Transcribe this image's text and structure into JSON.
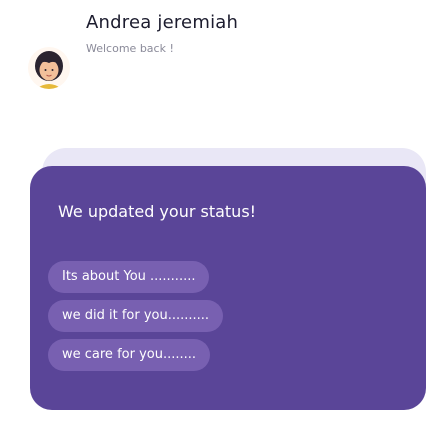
{
  "header": {
    "name": "Andrea jeremiah",
    "subtitle": "Welcome back !"
  },
  "card": {
    "title": "We updated your  status!",
    "messages": [
      "Its about You ...........",
      "we did it for you..........",
      "we care for you........"
    ]
  },
  "colors": {
    "card": "#5a4598",
    "pill": "#7860b1",
    "shadow": "#e9e7f6"
  }
}
